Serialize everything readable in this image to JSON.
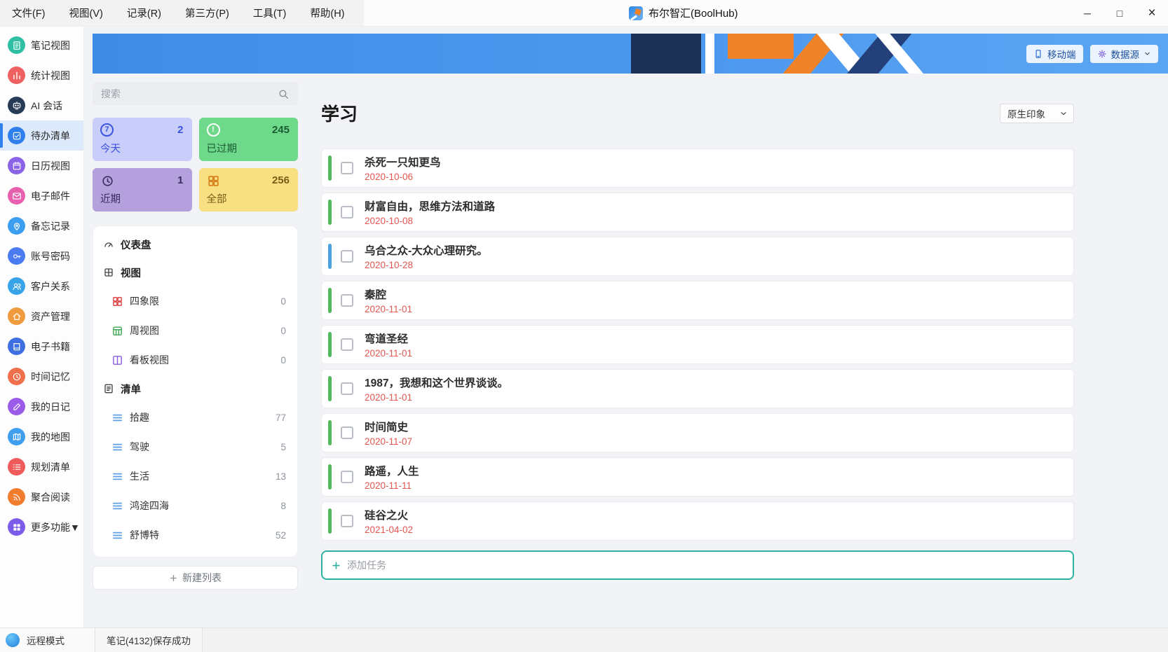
{
  "colors": {
    "accent_blue": "#2f80ed",
    "banner_blue": "#4190e8",
    "banner_navy": "#1d3156",
    "banner_orange": "#f08228",
    "date_red": "#e25650",
    "add_task_teal": "#2cb3a0",
    "selected_sidebar_bg": "#ddeafc"
  },
  "titlebar": {
    "app_title": "布尔智汇(BoolHub)",
    "menus": [
      {
        "label": "文件(F)"
      },
      {
        "label": "视图(V)"
      },
      {
        "label": "记录(R)"
      },
      {
        "label": "第三方(P)"
      },
      {
        "label": "工具(T)"
      },
      {
        "label": "帮助(H)"
      }
    ],
    "window_controls": {
      "minimize": "─",
      "maximize": "□",
      "close": "×"
    }
  },
  "banner": {
    "mobile_button": "移动端",
    "datasource_button": "数据源"
  },
  "sidebar": {
    "items": [
      {
        "label": "笔记视图",
        "icon": "note-icon",
        "color": "#2fbfa4"
      },
      {
        "label": "统计视图",
        "icon": "stats-icon",
        "color": "#ef6060"
      },
      {
        "label": "AI 会话",
        "icon": "ai-chat-icon",
        "color": "#273a56"
      },
      {
        "label": "待办清单",
        "icon": "todo-icon",
        "color": "#2f80ed",
        "selected": true
      },
      {
        "label": "日历视图",
        "icon": "calendar-icon",
        "color": "#8a63e6"
      },
      {
        "label": "电子邮件",
        "icon": "mail-icon",
        "color": "#e75fae"
      },
      {
        "label": "备忘记录",
        "icon": "pin-icon",
        "color": "#3c9ef0"
      },
      {
        "label": "账号密码",
        "icon": "key-icon",
        "color": "#4b7bf0"
      },
      {
        "label": "客户关系",
        "icon": "people-icon",
        "color": "#38a3e8"
      },
      {
        "label": "资产管理",
        "icon": "home-icon",
        "color": "#f09a3e"
      },
      {
        "label": "电子书籍",
        "icon": "book-icon",
        "color": "#3e6fe0"
      },
      {
        "label": "时间记忆",
        "icon": "clock-icon",
        "color": "#f0704b"
      },
      {
        "label": "我的日记",
        "icon": "pen-icon",
        "color": "#9a5ce8"
      },
      {
        "label": "我的地图",
        "icon": "map-icon",
        "color": "#3f9ef0"
      },
      {
        "label": "规划清单",
        "icon": "checklist-icon",
        "color": "#ef5a5a"
      },
      {
        "label": "聚合阅读",
        "icon": "rss-icon",
        "color": "#f07c2e"
      },
      {
        "label": "更多功能▼",
        "icon": "grid-icon",
        "color": "#7a5ce8"
      }
    ]
  },
  "panel": {
    "search_placeholder": "搜索",
    "stats": [
      {
        "label": "今天",
        "count": 2,
        "bg": "#c9cdf9",
        "fg": "#3c55e0",
        "icon_glyph": "7"
      },
      {
        "label": "已过期",
        "count": 245,
        "bg": "#6fd98b",
        "fg": "#1c5c32",
        "icon_glyph": "!"
      },
      {
        "label": "近期",
        "count": 1,
        "bg": "#b3a0dc",
        "fg": "#3a2b60",
        "icon_glyph": ""
      },
      {
        "label": "全部",
        "count": 256,
        "bg": "#f8df81",
        "fg": "#7a5c16",
        "icon_glyph": ""
      }
    ],
    "dashboard_label": "仪表盘",
    "views_label": "视图",
    "views": [
      {
        "label": "四象限",
        "count": 0
      },
      {
        "label": "周视图",
        "count": 0
      },
      {
        "label": "看板视图",
        "count": 0
      }
    ],
    "lists_label": "清单",
    "lists": [
      {
        "label": "拾趣",
        "count": 77
      },
      {
        "label": "驾驶",
        "count": 5
      },
      {
        "label": "生活",
        "count": 13
      },
      {
        "label": "鸿途四海",
        "count": 8
      },
      {
        "label": "舒博特",
        "count": 52
      }
    ],
    "new_list_button": "新建列表"
  },
  "main": {
    "title": "学习",
    "view_dropdown": "原生印象",
    "tasks": [
      {
        "title": "杀死一只知更鸟",
        "date": "2020-10-06",
        "accent": "#52b95c"
      },
      {
        "title": "财富自由，思维方法和道路",
        "date": "2020-10-08",
        "accent": "#52b95c"
      },
      {
        "title": "乌合之众-大众心理研究。",
        "date": "2020-10-28",
        "accent": "#4aa3e0"
      },
      {
        "title": "秦腔",
        "date": "2020-11-01",
        "accent": "#52b95c"
      },
      {
        "title": "弯道圣经",
        "date": "2020-11-01",
        "accent": "#52b95c"
      },
      {
        "title": "1987，我想和这个世界谈谈。",
        "date": "2020-11-01",
        "accent": "#52b95c"
      },
      {
        "title": "时间简史",
        "date": "2020-11-07",
        "accent": "#52b95c"
      },
      {
        "title": "路遥，人生",
        "date": "2020-11-11",
        "accent": "#52b95c"
      },
      {
        "title": "硅谷之火",
        "date": "2021-04-02",
        "accent": "#52b95c"
      }
    ],
    "add_task_placeholder": "添加任务"
  },
  "statusbar": {
    "mode": "远程模式",
    "message": "笔记(4132)保存成功"
  }
}
